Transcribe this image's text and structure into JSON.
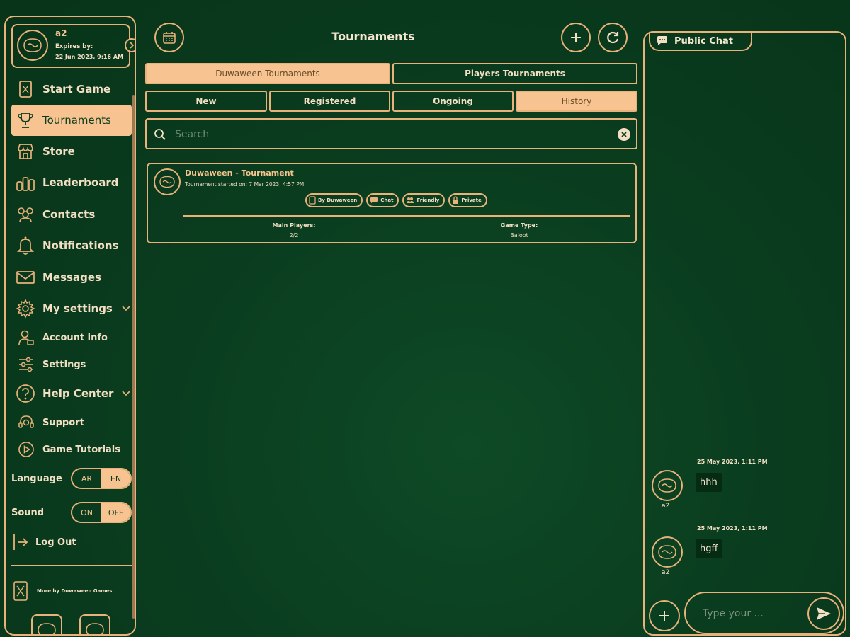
{
  "profile": {
    "username": "a2",
    "expires_label": "Expires by:",
    "expires_date": "22 Jun 2023, 9:16 AM"
  },
  "nav": {
    "start_game": "Start Game",
    "tournaments": "Tournaments",
    "store": "Store",
    "leaderboard": "Leaderboard",
    "contacts": "Contacts",
    "notifications": "Notifications",
    "messages": "Messages",
    "my_settings": "My settings",
    "account_info": "Account info",
    "settings": "Settings",
    "help_center": "Help Center",
    "support": "Support",
    "game_tutorials": "Game Tutorials",
    "log_out": "Log Out",
    "more_by": "More by Duwaween Games"
  },
  "language": {
    "label": "Language",
    "options": [
      "AR",
      "EN"
    ],
    "selected": "EN"
  },
  "sound": {
    "label": "Sound",
    "options": [
      "ON",
      "OFF"
    ],
    "selected": "OFF"
  },
  "main": {
    "title": "Tournaments",
    "source_tabs": [
      "Duwaween Tournaments",
      "Players Tournaments"
    ],
    "status_tabs": [
      "New",
      "Registered",
      "Ongoing",
      "History"
    ],
    "active_source_tab": "Duwaween Tournaments",
    "active_status_tab": "History",
    "search": {
      "placeholder": "Search",
      "value": ""
    }
  },
  "tournament": {
    "name": "Duwaween - Tournament",
    "started": "Tournament started on: 7 Mar 2023, 4:57 PM",
    "tags": [
      "By Duwaween",
      "Chat",
      "Friendly",
      "Private"
    ],
    "main_players_label": "Main Players:",
    "main_players_value": "2/2",
    "game_type_label": "Game Type:",
    "game_type_value": "Baloot"
  },
  "chat": {
    "title": "Public Chat",
    "messages": [
      {
        "time": "25 May 2023, 1:11 PM",
        "user": "a2",
        "text": "hhh"
      },
      {
        "time": "25 May 2023, 1:11 PM",
        "user": "a2",
        "text": "hgff"
      }
    ],
    "input_placeholder": "Type your ..."
  },
  "colors": {
    "gold": "#e8b27a",
    "peach": "#f7c491",
    "background": "#0a3d1f"
  }
}
